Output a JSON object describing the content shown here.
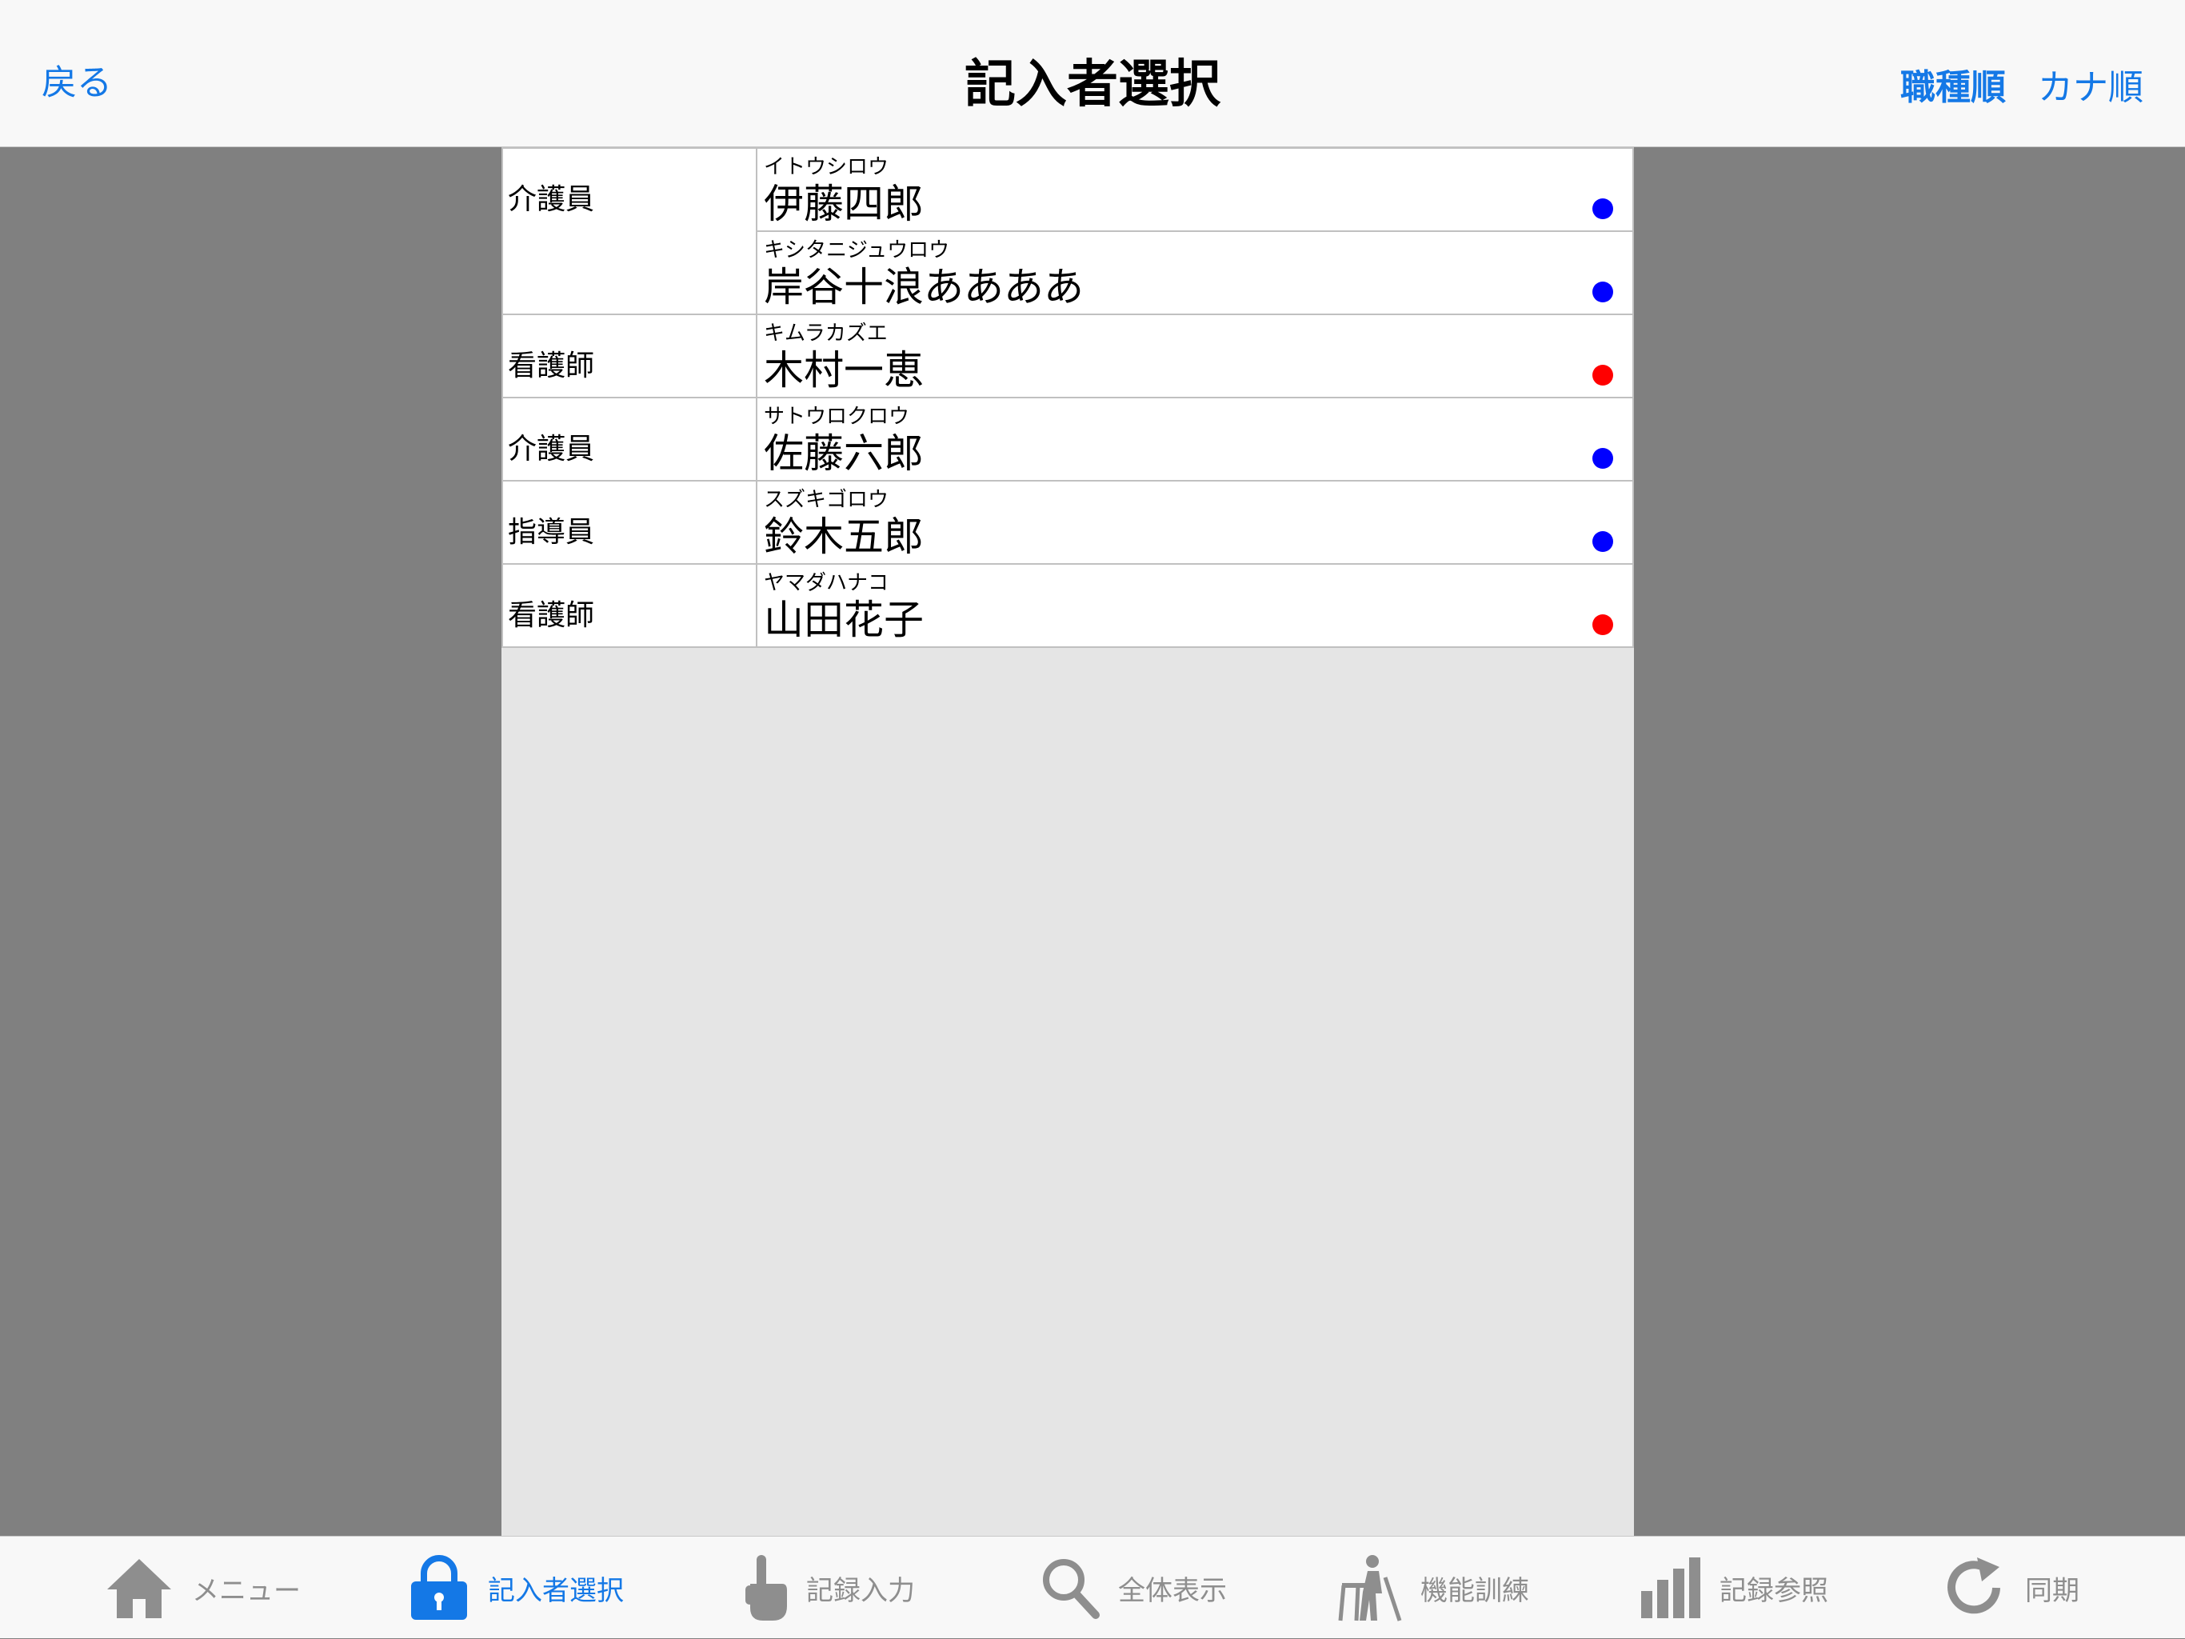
{
  "nav": {
    "back_label": "戻る",
    "title": "記入者選択",
    "sort_job_label": "職種順",
    "sort_kana_label": "カナ順"
  },
  "staff": [
    {
      "job": "介護員",
      "kana": "イトウシロウ",
      "name": "伊藤四郎",
      "dot": "#0000ff"
    },
    {
      "job": "",
      "kana": "キシタニジュウロウ",
      "name": "岸谷十浪ああああ",
      "dot": "#0000ff"
    },
    {
      "job": "看護師",
      "kana": "キムラカズエ",
      "name": "木村一恵",
      "dot": "#ff0000"
    },
    {
      "job": "介護員",
      "kana": "サトウロクロウ",
      "name": "佐藤六郎",
      "dot": "#0000ff"
    },
    {
      "job": "指導員",
      "kana": "スズキゴロウ",
      "name": "鈴木五郎",
      "dot": "#0000ff"
    },
    {
      "job": "看護師",
      "kana": "ヤマダハナコ",
      "name": "山田花子",
      "dot": "#ff0000"
    }
  ],
  "tabs": [
    {
      "label": "メニュー",
      "icon": "home-icon"
    },
    {
      "label": "記入者選択",
      "icon": "lock-icon",
      "active": true
    },
    {
      "label": "記録入力",
      "icon": "hand-pointer-icon"
    },
    {
      "label": "全体表示",
      "icon": "search-icon"
    },
    {
      "label": "機能訓練",
      "icon": "walker-icon"
    },
    {
      "label": "記録参照",
      "icon": "bar-chart-icon"
    },
    {
      "label": "同期",
      "icon": "sync-icon"
    }
  ],
  "colors": {
    "accent": "#1478e6",
    "inactive": "#8e8e8e",
    "dot_blue": "#0000ff",
    "dot_red": "#ff0000"
  }
}
